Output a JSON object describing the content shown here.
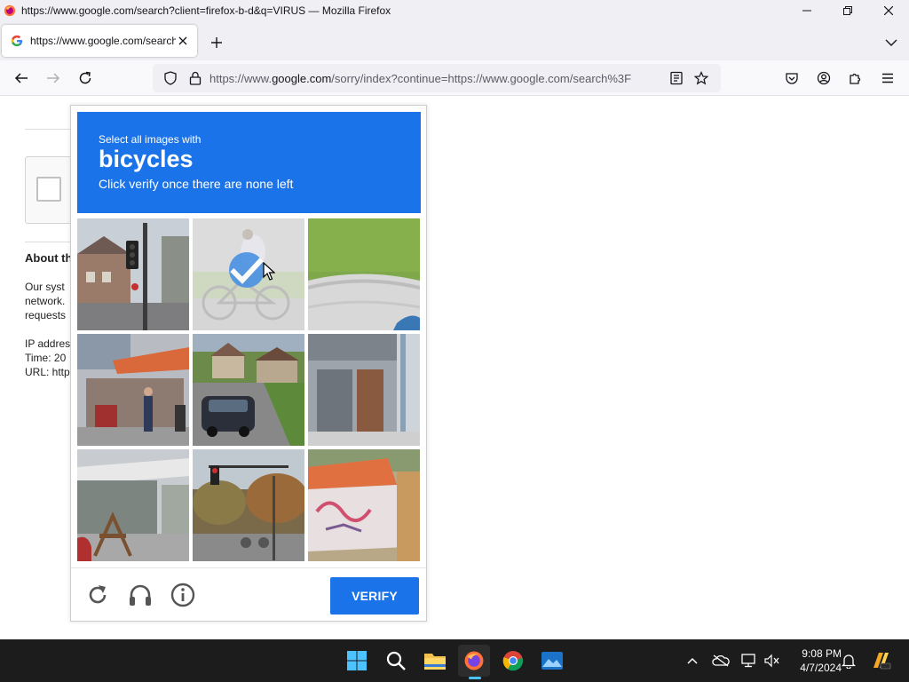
{
  "window": {
    "title": "https://www.google.com/search?client=firefox-b-d&q=VIRUS — Mozilla Firefox"
  },
  "tab": {
    "title": "https://www.google.com/search?client=firefox-b-d&q=VIRUS"
  },
  "urlbar": {
    "prefix": "https://www.",
    "domain": "google.com",
    "suffix": "/sorry/index?continue=https://www.google.com/search%3F"
  },
  "page": {
    "about_heading": "About th",
    "text_lines": [
      "Our syst",
      "network.",
      "requests"
    ],
    "info_lines": [
      "IP addres",
      "Time: 20",
      "URL: http"
    ]
  },
  "challenge": {
    "instruction": "Select all images with",
    "target": "bicycles",
    "subtext": "Click verify once there are none left",
    "tiles_selected": [
      false,
      true,
      false,
      false,
      false,
      false,
      false,
      false,
      false
    ],
    "verify_label": "VERIFY"
  },
  "taskbar": {
    "time": "9:08 PM",
    "date": "4/7/2024"
  },
  "colors": {
    "accent": "#1a73e8",
    "taskbar": "#1c1c1c"
  }
}
